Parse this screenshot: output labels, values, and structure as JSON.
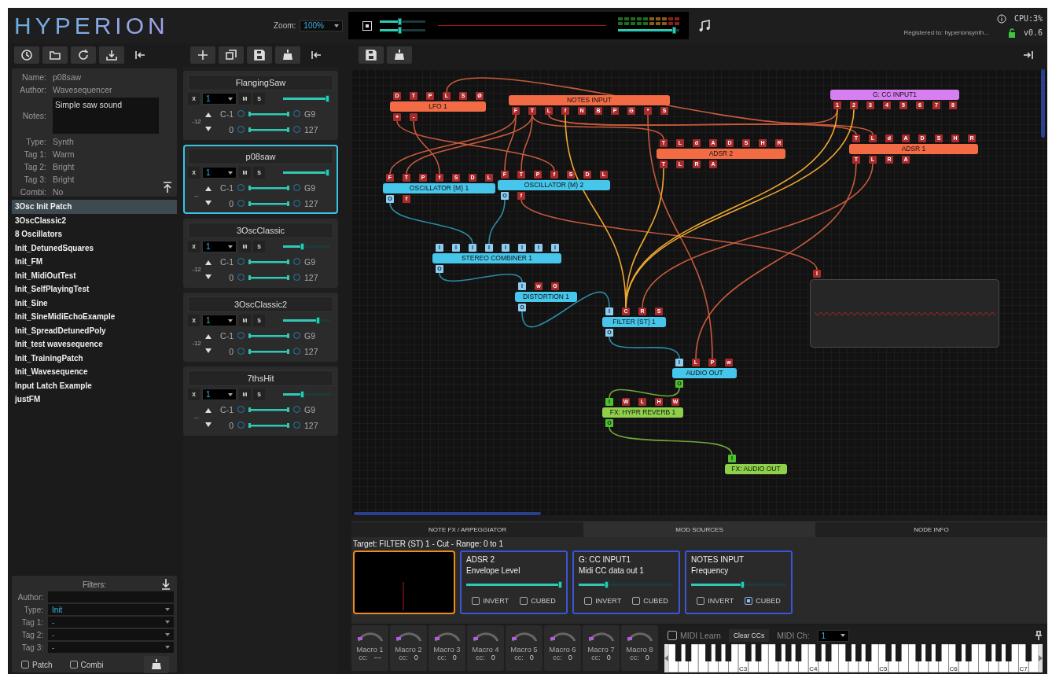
{
  "app": {
    "logo": "HYPERION",
    "zoom_label": "Zoom:",
    "zoom": "100%",
    "cpu": "CPU:3%",
    "registered": "Registered to: hyperionsynth...",
    "version": "v0.6"
  },
  "monitor": {
    "sliders": [
      {
        "level": 0.45
      },
      {
        "level": 0.45
      }
    ],
    "output": {
      "level": 0.92
    }
  },
  "patch": {
    "fields": [
      {
        "label": "Name:",
        "value": "p08saw",
        "kind": "text"
      },
      {
        "label": "Author:",
        "value": "Wavesequencer",
        "kind": "text"
      },
      {
        "label": "Notes:",
        "value": "Simple saw sound",
        "kind": "notes"
      },
      {
        "label": "Type:",
        "value": "Synth",
        "kind": "text"
      },
      {
        "label": "Tag 1:",
        "value": "Warm",
        "kind": "text"
      },
      {
        "label": "Tag 2:",
        "value": "Bright",
        "kind": "text"
      },
      {
        "label": "Tag 3:",
        "value": "Bright",
        "kind": "text"
      },
      {
        "label": "Combi:",
        "value": "No",
        "kind": "text"
      }
    ]
  },
  "patch_list": [
    {
      "name": "3Osc Init Patch",
      "selected": true
    },
    {
      "name": "3OscClassic2",
      "selected": false
    },
    {
      "name": "8 Oscillators",
      "selected": false
    },
    {
      "name": "Init_DetunedSquares",
      "selected": false
    },
    {
      "name": "Init_FM",
      "selected": false
    },
    {
      "name": "Init_MidiOutTest",
      "selected": false
    },
    {
      "name": "Init_SelfPlayingTest",
      "selected": false
    },
    {
      "name": "Init_Sine",
      "selected": false
    },
    {
      "name": "Init_SineMidiEchoExample",
      "selected": false
    },
    {
      "name": "Init_SpreadDetunedPoly",
      "selected": false
    },
    {
      "name": "Init_test wavesequence",
      "selected": false
    },
    {
      "name": "Init_TrainingPatch",
      "selected": false
    },
    {
      "name": "Init_Wavesequence",
      "selected": false
    },
    {
      "name": "Input Latch Example",
      "selected": false
    },
    {
      "name": "justFM",
      "selected": false
    }
  ],
  "filters": {
    "title": "Filters:",
    "fields": [
      {
        "label": "Author:",
        "kind": "text"
      },
      {
        "label": "Type:",
        "value": "Init",
        "kind": "dropdown"
      },
      {
        "label": "Tag 1:",
        "value": "-",
        "kind": "dropdown"
      },
      {
        "label": "Tag 2:",
        "value": "-",
        "kind": "dropdown"
      },
      {
        "label": "Tag 3:",
        "value": "-",
        "kind": "dropdown"
      }
    ],
    "checkboxes": [
      {
        "label": "Patch",
        "checked": false
      },
      {
        "label": "Combi",
        "checked": false
      }
    ]
  },
  "slots": [
    {
      "name": "FlangingSaw",
      "selected": false,
      "remove": "X",
      "channel": "1",
      "mute": "M",
      "solo": "S",
      "level": 0.95,
      "transpose": "-12",
      "low_key": "C-1",
      "high_key": "G9",
      "low_vel": "0",
      "high_vel": "127"
    },
    {
      "name": "p08saw",
      "selected": true,
      "remove": "X",
      "channel": "1",
      "mute": "M",
      "solo": "S",
      "level": 0.95,
      "transpose": "--",
      "low_key": "C-1",
      "high_key": "G9",
      "low_vel": "0",
      "high_vel": "127"
    },
    {
      "name": "3OscClassic",
      "selected": false,
      "remove": "X",
      "channel": "1",
      "mute": "M",
      "solo": "S",
      "level": 0.42,
      "transpose": "-12",
      "low_key": "C-1",
      "high_key": "G9",
      "low_vel": "0",
      "high_vel": "127"
    },
    {
      "name": "3OscClassic2",
      "selected": false,
      "remove": "X",
      "channel": "1",
      "mute": "M",
      "solo": "S",
      "level": 0.75,
      "transpose": "-12",
      "low_key": "C-1",
      "high_key": "G9",
      "low_vel": "0",
      "high_vel": "127"
    },
    {
      "name": "7thsHit",
      "selected": false,
      "remove": "X",
      "channel": "1",
      "mute": "M",
      "solo": "S",
      "level": 0.42,
      "transpose": "--",
      "low_key": "C-1",
      "high_key": "G9",
      "low_vel": "0",
      "high_vel": "127"
    }
  ],
  "graph": {
    "nodes": [
      {
        "title": "LFO 1",
        "kind": "mod",
        "inputs": [
          {
            "label": "D",
            "kind": "mod"
          },
          {
            "label": "T",
            "kind": "mod"
          },
          {
            "label": "P",
            "kind": "mod"
          },
          {
            "label": "L",
            "kind": "mod"
          },
          {
            "label": "S",
            "kind": "mod"
          },
          {
            "label": "Ø",
            "kind": "mod"
          }
        ],
        "outputs": [
          {
            "label": "+",
            "kind": "mod"
          },
          {
            "label": "-",
            "kind": "mod"
          }
        ]
      },
      {
        "title": "NOTES INPUT",
        "kind": "mod",
        "outputs": [
          {
            "label": "F",
            "kind": "mod"
          },
          {
            "label": "T",
            "kind": "mod"
          },
          {
            "label": "L",
            "kind": "mod"
          },
          {
            "label": "f",
            "kind": "mod"
          },
          {
            "label": "N",
            "kind": "mod"
          },
          {
            "label": "B",
            "kind": "mod"
          },
          {
            "label": "P",
            "kind": "mod"
          },
          {
            "label": "G",
            "kind": "mod"
          },
          {
            "label": "*",
            "kind": "mod"
          },
          {
            "label": "S",
            "kind": "mod"
          }
        ]
      },
      {
        "title": "G: CC INPUT1",
        "kind": "global",
        "outputs": [
          {
            "label": "1",
            "kind": "mod"
          },
          {
            "label": "2",
            "kind": "mod"
          },
          {
            "label": "3",
            "kind": "mod"
          },
          {
            "label": "4",
            "kind": "mod"
          },
          {
            "label": "5",
            "kind": "mod"
          },
          {
            "label": "6",
            "kind": "mod"
          },
          {
            "label": "7",
            "kind": "mod"
          },
          {
            "label": "8",
            "kind": "mod"
          }
        ]
      },
      {
        "title": "ADSR 2",
        "kind": "mod",
        "inputs": [
          {
            "label": "T",
            "kind": "mod"
          },
          {
            "label": "L",
            "kind": "mod"
          },
          {
            "label": "d",
            "kind": "mod"
          },
          {
            "label": "A",
            "kind": "mod"
          },
          {
            "label": "D",
            "kind": "mod"
          },
          {
            "label": "S",
            "kind": "mod"
          },
          {
            "label": "H",
            "kind": "mod"
          },
          {
            "label": "R",
            "kind": "mod"
          }
        ],
        "outputs": [
          {
            "label": "T",
            "kind": "mod"
          },
          {
            "label": "L",
            "kind": "mod"
          },
          {
            "label": "R",
            "kind": "mod"
          },
          {
            "label": "A",
            "kind": "mod"
          }
        ]
      },
      {
        "title": "ADSR 1",
        "kind": "mod",
        "inputs": [
          {
            "label": "T",
            "kind": "mod"
          },
          {
            "label": "L",
            "kind": "mod"
          },
          {
            "label": "d",
            "kind": "mod"
          },
          {
            "label": "A",
            "kind": "mod"
          },
          {
            "label": "D",
            "kind": "mod"
          },
          {
            "label": "S",
            "kind": "mod"
          },
          {
            "label": "H",
            "kind": "mod"
          },
          {
            "label": "R",
            "kind": "mod"
          }
        ],
        "outputs": [
          {
            "label": "T",
            "kind": "mod"
          },
          {
            "label": "L",
            "kind": "mod"
          },
          {
            "label": "R",
            "kind": "mod"
          },
          {
            "label": "A",
            "kind": "mod"
          }
        ]
      },
      {
        "title": "OSCILLATOR (M) 1",
        "kind": "audio",
        "inputs": [
          {
            "label": "F",
            "kind": "mod"
          },
          {
            "label": "T",
            "kind": "mod"
          },
          {
            "label": "P",
            "kind": "mod"
          },
          {
            "label": "f",
            "kind": "mod"
          },
          {
            "label": "S",
            "kind": "mod"
          },
          {
            "label": "D",
            "kind": "mod"
          },
          {
            "label": "L",
            "kind": "mod"
          }
        ],
        "outputs": [
          {
            "label": "O",
            "kind": "audio"
          },
          {
            "label": "f",
            "kind": "mod"
          }
        ]
      },
      {
        "title": "OSCILLATOR (M) 2",
        "kind": "audio",
        "inputs": [
          {
            "label": "F",
            "kind": "mod"
          },
          {
            "label": "T",
            "kind": "mod"
          },
          {
            "label": "P",
            "kind": "mod"
          },
          {
            "label": "f",
            "kind": "mod"
          },
          {
            "label": "S",
            "kind": "mod"
          },
          {
            "label": "D",
            "kind": "mod"
          },
          {
            "label": "L",
            "kind": "mod"
          }
        ],
        "outputs": [
          {
            "label": "O",
            "kind": "audio"
          },
          {
            "label": "f",
            "kind": "mod"
          }
        ]
      },
      {
        "title": "STEREO COMBINER 1",
        "kind": "audio",
        "inputs": [
          {
            "label": "I",
            "kind": "audio"
          },
          {
            "label": "I",
            "kind": "audio"
          },
          {
            "label": "I",
            "kind": "audio"
          },
          {
            "label": "I",
            "kind": "audio"
          },
          {
            "label": "I",
            "kind": "audio"
          },
          {
            "label": "I",
            "kind": "audio"
          },
          {
            "label": "I",
            "kind": "audio"
          },
          {
            "label": "I",
            "kind": "audio"
          }
        ],
        "outputs": [
          {
            "label": "O",
            "kind": "audio"
          }
        ]
      },
      {
        "title": "DISTORTION 1",
        "kind": "audio",
        "inputs": [
          {
            "label": "I",
            "kind": "audio"
          },
          {
            "label": "w",
            "kind": "mod"
          },
          {
            "label": "G",
            "kind": "mod"
          }
        ],
        "outputs": [
          {
            "label": "O",
            "kind": "audio"
          }
        ]
      },
      {
        "title": "FILTER (ST) 1",
        "kind": "audio",
        "inputs": [
          {
            "label": "I",
            "kind": "audio"
          },
          {
            "label": "C",
            "kind": "mod"
          },
          {
            "label": "R",
            "kind": "mod"
          },
          {
            "label": "S",
            "kind": "mod"
          }
        ],
        "outputs": [
          {
            "label": "O",
            "kind": "audio"
          }
        ]
      },
      {
        "title": "AUDIO OUT",
        "kind": "audio",
        "inputs": [
          {
            "label": "I",
            "kind": "audio"
          },
          {
            "label": "L",
            "kind": "mod"
          },
          {
            "label": "P",
            "kind": "mod"
          },
          {
            "label": "w",
            "kind": "mod"
          }
        ],
        "outputs": [
          {
            "label": "O",
            "kind": "fx"
          }
        ]
      },
      {
        "title": "FX: HYPR REVERB 1",
        "kind": "fx",
        "inputs": [
          {
            "label": "I",
            "kind": "fx"
          },
          {
            "label": "W",
            "kind": "mod"
          },
          {
            "label": "L",
            "kind": "mod"
          },
          {
            "label": "H",
            "kind": "mod"
          },
          {
            "label": "W",
            "kind": "mod"
          }
        ],
        "outputs": [
          {
            "label": "O",
            "kind": "fx"
          }
        ]
      },
      {
        "title": "FX: AUDIO OUT",
        "kind": "fx",
        "inputs": [
          {
            "label": "I",
            "kind": "fx"
          }
        ]
      },
      {
        "kind": "scope",
        "inputs": [
          {
            "label": "I",
            "kind": "mod"
          }
        ]
      }
    ]
  },
  "bottom_tabs": [
    {
      "label": "NOTE FX / ARPEGGIATOR",
      "selected": false
    },
    {
      "label": "MOD SOURCES",
      "selected": true
    },
    {
      "label": "NODE INFO",
      "selected": false
    }
  ],
  "mod_panel": {
    "target": "Target: FILTER (ST) 1 - Cut - Range: 0 to 1",
    "sources": [
      {
        "title": "ADSR 2",
        "subtitle": "Envelope Level",
        "level": 1.0,
        "options": [
          {
            "label": "INVERT",
            "checked": false
          },
          {
            "label": "CUBED",
            "checked": false
          }
        ]
      },
      {
        "title": "G: CC INPUT1",
        "subtitle": "Midi CC data out 1",
        "level": 0.3,
        "options": [
          {
            "label": "INVERT",
            "checked": false
          },
          {
            "label": "CUBED",
            "checked": false
          }
        ]
      },
      {
        "title": "NOTES INPUT",
        "subtitle": "Frequency",
        "level": 0.55,
        "options": [
          {
            "label": "INVERT",
            "checked": false
          },
          {
            "label": "CUBED",
            "checked": true
          }
        ]
      }
    ]
  },
  "macros": [
    {
      "label": "Macro 1",
      "cc_label": "cc:",
      "cc": "---"
    },
    {
      "label": "Macro 2",
      "cc_label": "cc:",
      "cc": "0"
    },
    {
      "label": "Macro 3",
      "cc_label": "cc:",
      "cc": "0"
    },
    {
      "label": "Macro 4",
      "cc_label": "cc:",
      "cc": "0"
    },
    {
      "label": "Macro 5",
      "cc_label": "cc:",
      "cc": "0"
    },
    {
      "label": "Macro 6",
      "cc_label": "cc:",
      "cc": "0"
    },
    {
      "label": "Macro 7",
      "cc_label": "cc:",
      "cc": "0"
    },
    {
      "label": "Macro 8",
      "cc_label": "cc:",
      "cc": "0"
    }
  ],
  "midi": {
    "learn": {
      "label": "MIDI Learn",
      "checked": false
    },
    "clear": "Clear CCs",
    "channel_label": "MIDI Ch:",
    "channel": "1"
  },
  "keyboard": {
    "octave_labels": [
      "C3",
      "C4",
      "C5",
      "C6",
      "C7"
    ]
  }
}
